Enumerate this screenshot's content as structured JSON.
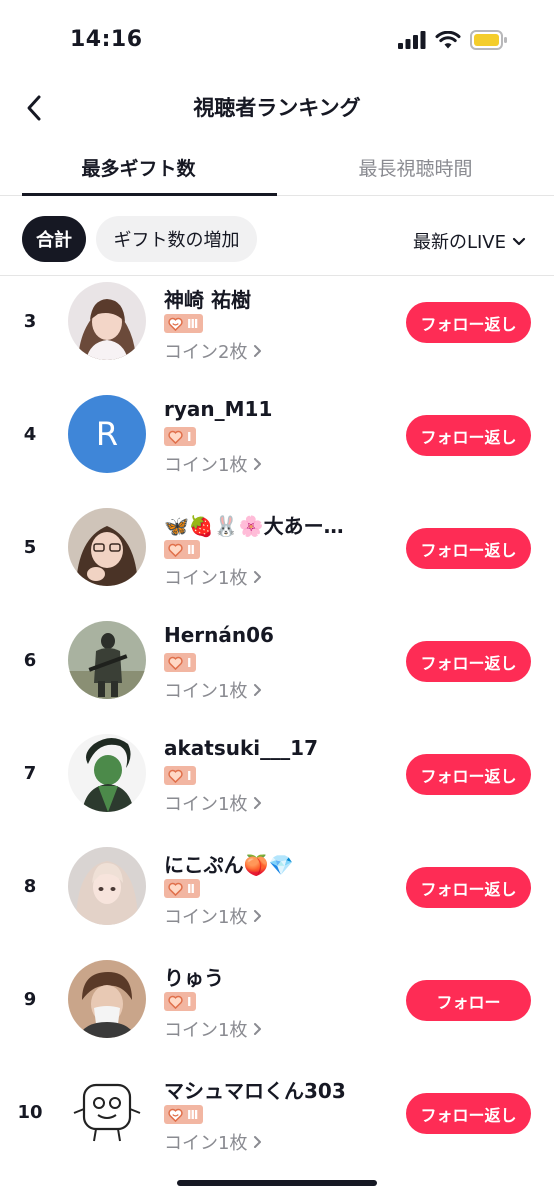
{
  "status_bar": {
    "time": "14:16"
  },
  "header": {
    "title": "視聴者ランキング"
  },
  "tabs": [
    {
      "label": "最多ギフト数",
      "active": true
    },
    {
      "label": "最長視聴時間",
      "active": false
    }
  ],
  "filters": {
    "total_label": "合計",
    "increase_label": "ギフト数の増加",
    "sort_label": "最新のLIVE"
  },
  "colors": {
    "accent": "#fe2c55",
    "badge": "#f2b6a2",
    "text": "#161823",
    "muted": "#8a8b91"
  },
  "rows": [
    {
      "rank": "3",
      "name": "神崎 祐樹",
      "level": "III",
      "coins": "コイン2枚",
      "button": "フォロー返し",
      "avatar": "photo-avatar"
    },
    {
      "rank": "4",
      "name": "ryan_M11",
      "level": "I",
      "coins": "コイン1枚",
      "button": "フォロー返し",
      "avatar": "letter-avatar",
      "avatar_letter": "R"
    },
    {
      "rank": "5",
      "name": "🦋🍓🐰🌸大あー…",
      "level": "II",
      "coins": "コイン1枚",
      "button": "フォロー返し",
      "avatar": "photo-avatar"
    },
    {
      "rank": "6",
      "name": "Hernán06",
      "level": "I",
      "coins": "コイン1枚",
      "button": "フォロー返し",
      "avatar": "photo-avatar"
    },
    {
      "rank": "7",
      "name": "akatsuki___17",
      "level": "I",
      "coins": "コイン1枚",
      "button": "フォロー返し",
      "avatar": "illustration-avatar"
    },
    {
      "rank": "8",
      "name": "にこぷん🍑💎",
      "level": "II",
      "coins": "コイン1枚",
      "button": "フォロー返し",
      "avatar": "photo-avatar"
    },
    {
      "rank": "9",
      "name": "りゅう",
      "level": "I",
      "coins": "コイン1枚",
      "button": "フォロー",
      "avatar": "photo-avatar"
    },
    {
      "rank": "10",
      "name": "マシュマロくん303",
      "level": "III",
      "coins": "コイン1枚",
      "button": "フォロー返し",
      "avatar": "drawing-avatar"
    }
  ]
}
